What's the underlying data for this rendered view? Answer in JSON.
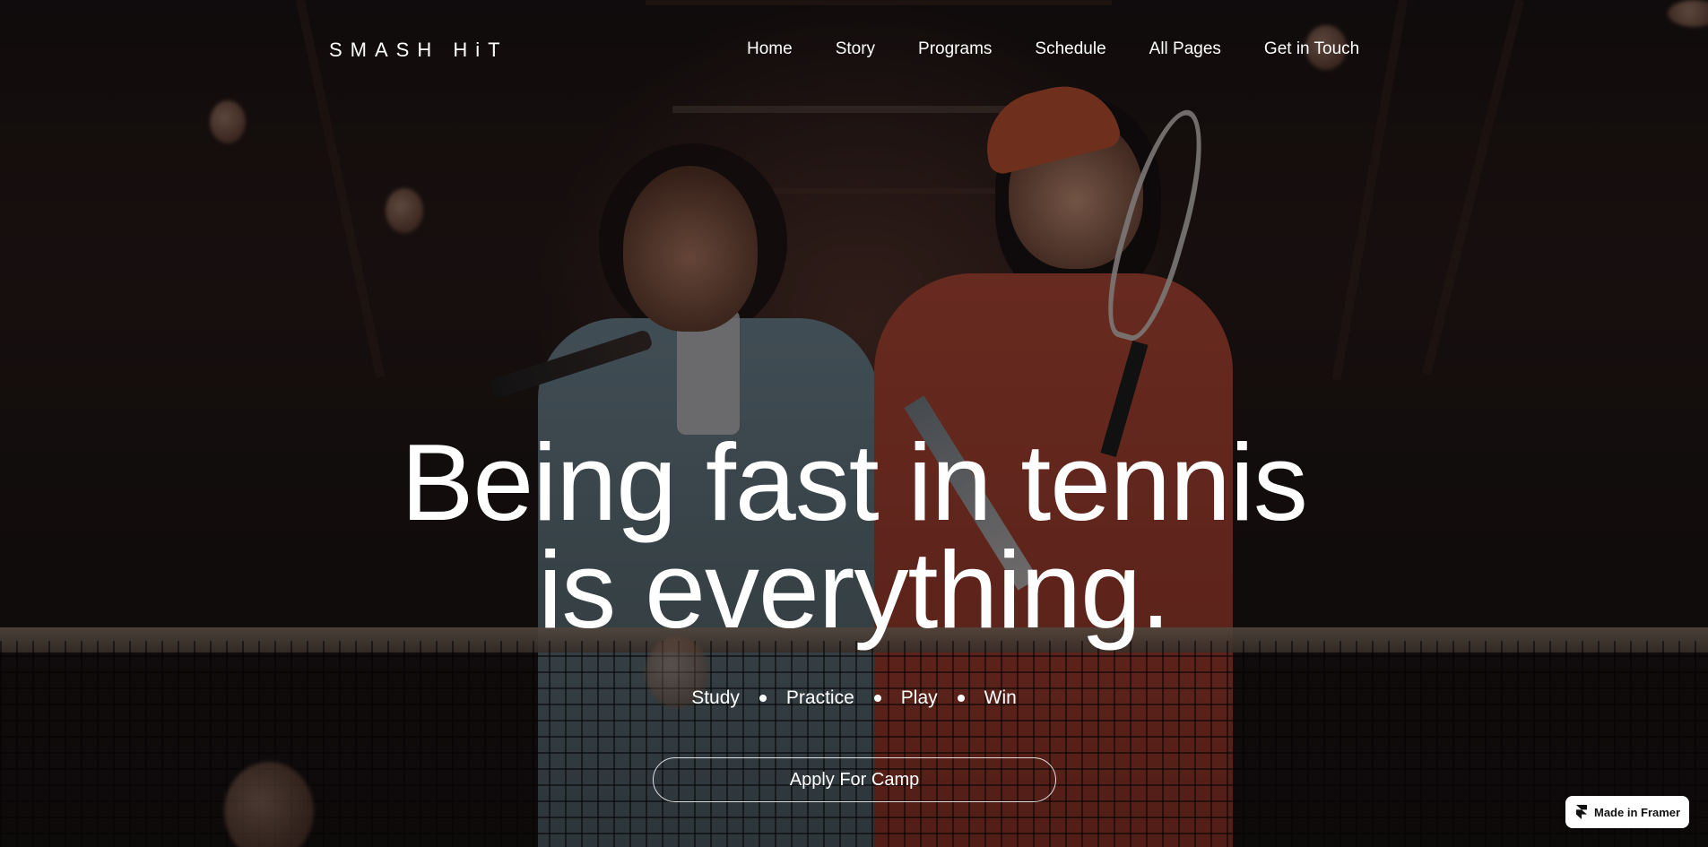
{
  "brand": {
    "name": "SMASH HiT"
  },
  "nav": {
    "items": [
      {
        "label": "Home"
      },
      {
        "label": "Story"
      },
      {
        "label": "Programs"
      },
      {
        "label": "Schedule"
      },
      {
        "label": "All Pages"
      },
      {
        "label": "Get in Touch"
      }
    ]
  },
  "hero": {
    "headline_line1": "Being fast in tennis",
    "headline_line2": "is everything.",
    "tags": [
      "Study",
      "Practice",
      "Play",
      "Win"
    ],
    "cta_label": "Apply For Camp"
  },
  "badge": {
    "label": "Made in Framer",
    "icon": "framer-logo-icon"
  },
  "colors": {
    "text": "#ffffff",
    "background": "#0b0a0c",
    "badge_bg": "#ffffff",
    "badge_text": "#111111"
  }
}
